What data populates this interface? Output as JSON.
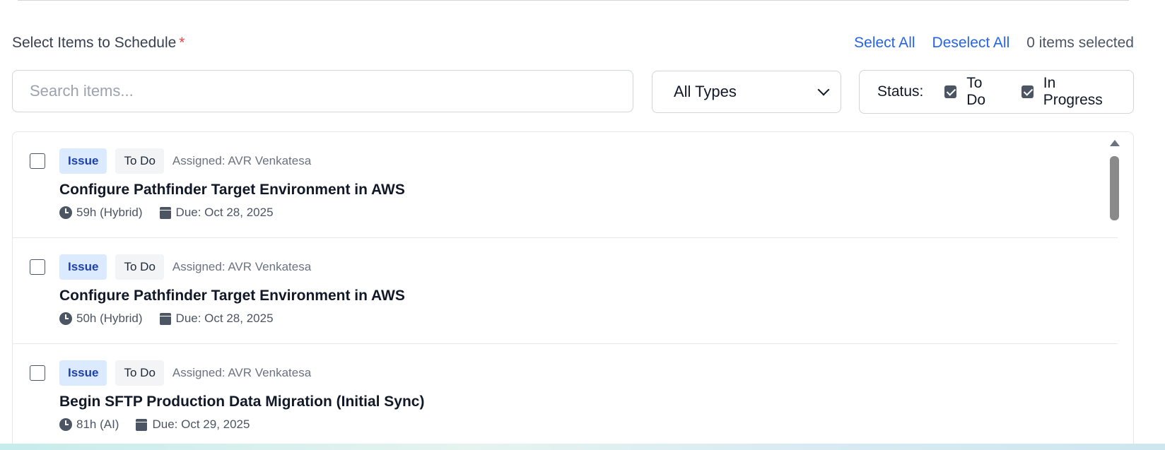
{
  "section": {
    "title": "Select Items to Schedule",
    "required_mark": "*",
    "select_all": "Select All",
    "deselect_all": "Deselect All",
    "selected_count": "0 items selected"
  },
  "filters": {
    "search_placeholder": "Search items...",
    "type_value": "All Types",
    "status_label": "Status:",
    "status_options": [
      {
        "label": "To Do",
        "checked": true
      },
      {
        "label": "In Progress",
        "checked": true
      }
    ]
  },
  "items": [
    {
      "type": "Issue",
      "status": "To Do",
      "assigned": "Assigned: AVR Venkatesa",
      "title": "Configure Pathfinder Target Environment in AWS",
      "hours": "59h (Hybrid)",
      "due": "Due: Oct 28, 2025",
      "checked": false
    },
    {
      "type": "Issue",
      "status": "To Do",
      "assigned": "Assigned: AVR Venkatesa",
      "title": "Configure Pathfinder Target Environment in AWS",
      "hours": "50h (Hybrid)",
      "due": "Due: Oct 28, 2025",
      "checked": false
    },
    {
      "type": "Issue",
      "status": "To Do",
      "assigned": "Assigned: AVR Venkatesa",
      "title": "Begin SFTP Production Data Migration (Initial Sync)",
      "hours": "81h (AI)",
      "due": "Due: Oct 29, 2025",
      "checked": false
    }
  ],
  "colors": {
    "accent_link": "#2563eb",
    "type_badge_bg": "#dbeafe",
    "type_badge_text": "#1e40af",
    "status_badge_bg": "#f3f4f6",
    "required": "#ef4444"
  },
  "icons": {
    "hours": "clock-icon",
    "due": "calendar-icon",
    "select_arrow": "chevron-down-icon"
  }
}
